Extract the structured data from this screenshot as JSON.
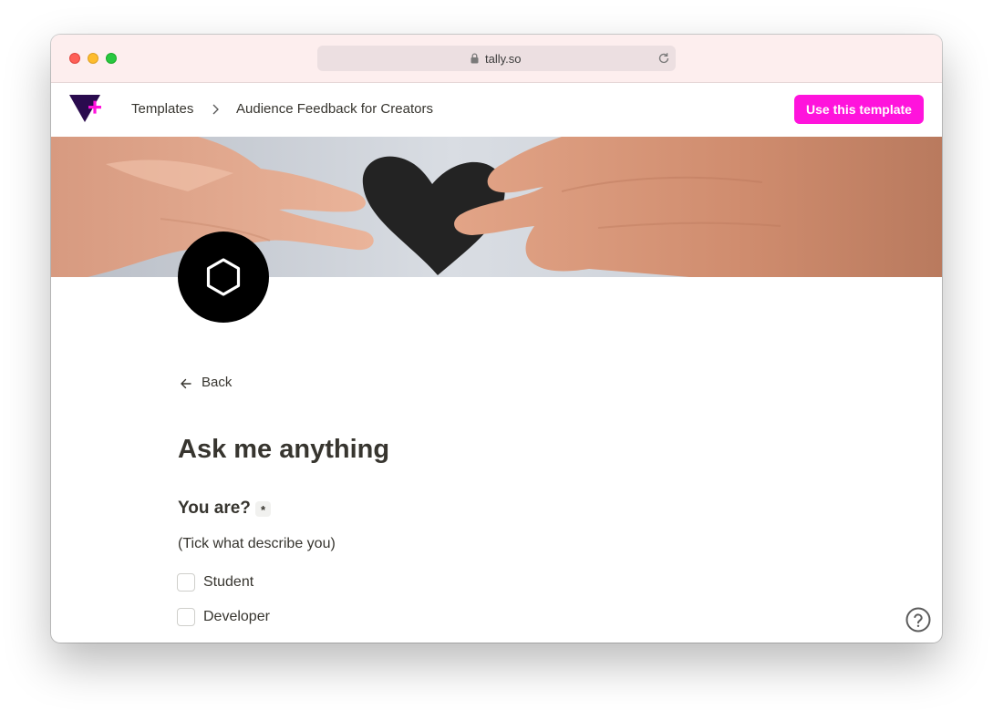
{
  "browser": {
    "url": "tally.so",
    "icons": [
      "lock-icon",
      "reload-icon"
    ]
  },
  "nav": {
    "breadcrumb_templates": "Templates",
    "breadcrumb_current": "Audience Feedback for Creators",
    "cta_label": "Use this template"
  },
  "form": {
    "back_label": "Back",
    "title": "Ask me anything",
    "question": "You are?",
    "required_mark": "*",
    "hint": "(Tick what describe you)",
    "options": [
      "Student",
      "Developer"
    ]
  },
  "colors": {
    "accent": "#ff13dc",
    "titlebar": "#fdeeee",
    "text": "#37352f"
  }
}
